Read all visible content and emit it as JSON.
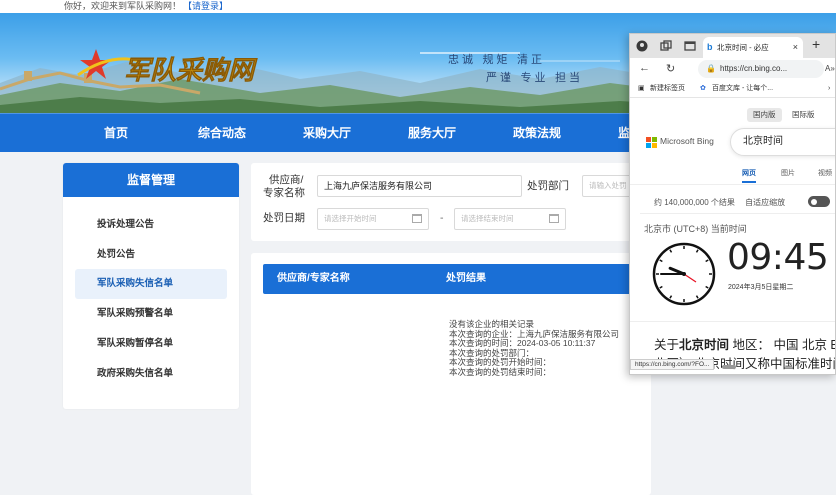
{
  "topbar": {
    "welcome": "你好，欢迎来到军队采购网！",
    "login": "【请登录】"
  },
  "banner": {
    "logo_text": "军队采购网",
    "slogan_line1": "忠诚  规矩  清正",
    "slogan_line2": "严谨  专业  担当"
  },
  "nav": {
    "items": [
      "首页",
      "综合动态",
      "采购大厅",
      "服务大厅",
      "政策法规",
      "监"
    ]
  },
  "sidebar": {
    "title": "监督管理",
    "items": [
      "投诉处理公告",
      "处罚公告",
      "军队采购失信名单",
      "军队采购预警名单",
      "军队采购暂停名单",
      "政府采购失信名单"
    ],
    "active_index": 2
  },
  "search": {
    "supplier_label_1": "供应商/",
    "supplier_label_2": "专家名称",
    "supplier_value": "上海九庐保洁服务有限公司",
    "dept_label": "处罚部门",
    "dept_placeholder": "请输入处罚",
    "date_label": "处罚日期",
    "start_placeholder": "请选择开始时间",
    "range_sep": "-",
    "end_placeholder": "请选择结束时间"
  },
  "results": {
    "col_supplier": "供应商/专家名称",
    "col_result": "处罚结果",
    "message_lines": [
      "没有该企业的相关记录",
      "本次查询的企业：上海九庐保洁服务有限公司",
      "本次查询的时间：2024-03-05 10:11:37",
      "本次查询的处罚部门：",
      "本次查询的处罚开始时间：",
      "本次查询的处罚结束时间："
    ]
  },
  "browser": {
    "tab_title": "北京时间 - 必应",
    "tab_close": "×",
    "new_tab": "+",
    "address": "https://cn.bing.co...",
    "read_aloud": "A»",
    "favorites": [
      "新建标签页",
      "百度文库 - 让每个..."
    ],
    "regions": [
      "国内版",
      "国际版"
    ],
    "bing_name": "Microsoft Bing",
    "query": "北京时间",
    "vertical_tabs": [
      "网页",
      "图片",
      "视频"
    ],
    "result_count": "约 140,000,000 个结果",
    "safe_search": "自适应缩放",
    "city": "北京市 (UTC+8) 当前时间",
    "time": "09:45",
    "date": "2024年3月5日星期二",
    "desc_prefix": "关于",
    "desc_bold": "北京时间",
    "desc_suffix": " 地区：  中国  北京 B",
    "desc_line2": "北区） 北京时间又称中国标准时间",
    "status_url": "https://cn.bing.com/?FO...",
    "clock_hour": 9,
    "clock_minute": 45
  },
  "colors": {
    "brand_blue": "#1a6fd6",
    "link_blue": "#1a66cc"
  }
}
